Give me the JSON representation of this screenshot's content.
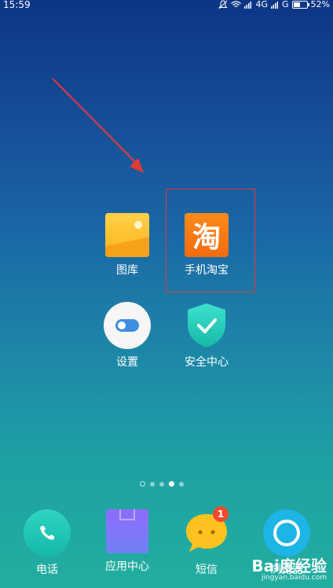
{
  "status_bar": {
    "time": "15:59",
    "network": "4G",
    "network2": "G",
    "battery_percent": "52%",
    "battery_level": 0.52
  },
  "home": {
    "apps": [
      {
        "name": "gallery",
        "label": "图库"
      },
      {
        "name": "taobao",
        "label": "手机淘宝",
        "icon_text": "淘"
      },
      {
        "name": "settings",
        "label": "设置"
      },
      {
        "name": "security",
        "label": "安全中心"
      }
    ],
    "page_indicator": {
      "pages": 4,
      "active_page": 3
    }
  },
  "dock": {
    "apps": [
      {
        "name": "phone",
        "label": "电话"
      },
      {
        "name": "app-center",
        "label": "应用中心"
      },
      {
        "name": "sms",
        "label": "短信",
        "badge": "1"
      },
      {
        "name": "browser",
        "label": "浏览器"
      }
    ]
  },
  "watermark": {
    "brand": "Bai度经验",
    "url": "jingyan.baidu.com"
  },
  "colors": {
    "highlight": "#e53935",
    "arrow": "#e53935",
    "taobao_orange": "#f26b0f",
    "badge": "#f24a2c"
  }
}
